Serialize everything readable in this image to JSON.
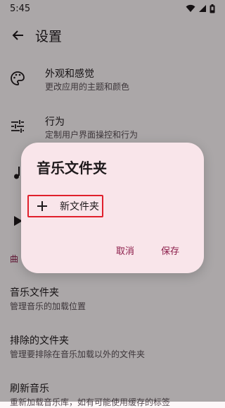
{
  "status_bar": {
    "time": "5:45"
  },
  "header": {
    "title": "设置",
    "back_icon": "arrow-back-icon"
  },
  "settings": [
    {
      "title": "外观和感觉",
      "subtitle": "更改应用的主题和颜色",
      "icon": "palette-icon"
    },
    {
      "title": "行为",
      "subtitle": "定制用户界面操控和行为",
      "icon": "tune-icon"
    },
    {
      "title": "",
      "subtitle": "",
      "icon": "music-note-icon"
    },
    {
      "title": "",
      "subtitle": "",
      "icon": "play-icon"
    }
  ],
  "section": {
    "label": "曲"
  },
  "library": [
    {
      "title": "音乐文件夹",
      "subtitle": "管理音乐的加载位置"
    },
    {
      "title": "排除的文件夹",
      "subtitle": "管理要排除在音乐加载以外的文件夹"
    },
    {
      "title": "刷新音乐",
      "subtitle": "重新加载音乐库，如有可能使用缓存的标签"
    }
  ],
  "dialog": {
    "title": "音乐文件夹",
    "new_folder_label": "新文件夹",
    "cancel_label": "取消",
    "save_label": "保存"
  },
  "colors": {
    "accent": "#8c1d4a",
    "dialog_bg": "#f9e5ea",
    "highlight": "#e0202c"
  }
}
